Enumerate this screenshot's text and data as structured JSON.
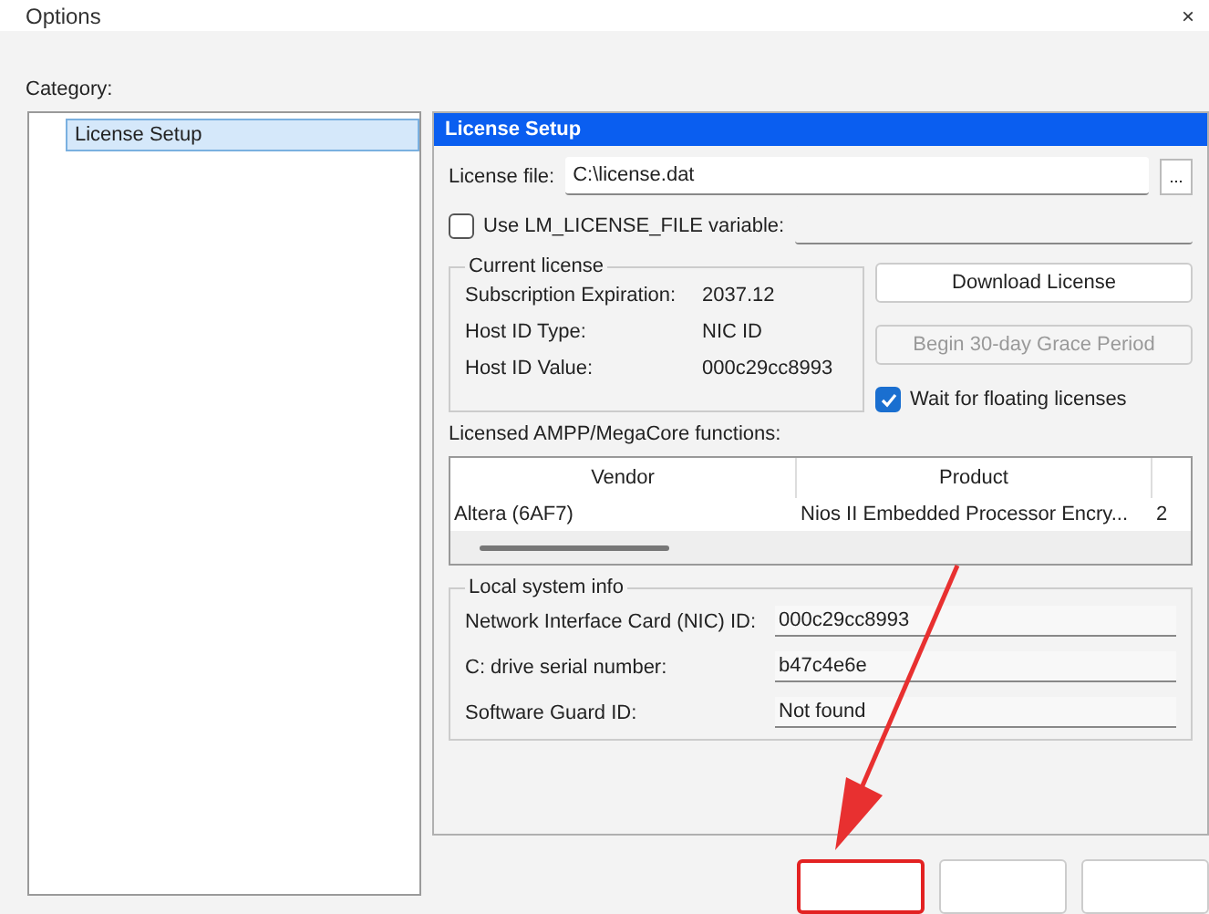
{
  "window": {
    "title": "Options",
    "close": "×"
  },
  "category_label": "Category:",
  "sidebar": {
    "items": [
      {
        "label": "License Setup",
        "selected": true
      }
    ]
  },
  "panel": {
    "title": "License Setup",
    "license_file": {
      "label": "License file:",
      "value": "C:\\license.dat",
      "browse": "..."
    },
    "lm_variable": {
      "label": "Use LM_LICENSE_FILE variable:",
      "checked": false
    },
    "current_license": {
      "title": "Current license",
      "rows": [
        {
          "label": "Subscription Expiration:",
          "value": "2037.12"
        },
        {
          "label": "Host ID Type:",
          "value": "NIC ID"
        },
        {
          "label": "Host ID Value:",
          "value": "000c29cc8993"
        }
      ]
    },
    "download_button": {
      "label": "Download License"
    },
    "grace_button": {
      "label": "Begin 30-day Grace Period",
      "disabled": true
    },
    "wait_floating": {
      "label": "Wait for floating licenses",
      "checked": true
    },
    "functions_label": "Licensed AMPP/MegaCore functions:",
    "table": {
      "columns": [
        "Vendor",
        "Product"
      ],
      "rows": [
        [
          "Altera (6AF7)",
          "Nios II Embedded Processor Encry...",
          "2"
        ]
      ]
    },
    "local_info": {
      "title": "Local system info",
      "rows": [
        {
          "label": "Network Interface Card (NIC) ID:",
          "value": "000c29cc8993"
        },
        {
          "label": "C: drive serial number:",
          "value": "b47c4e6e"
        },
        {
          "label": "Software Guard ID:",
          "value": "Not found"
        }
      ]
    }
  },
  "buttons": [
    {
      "highlighted": true
    },
    {
      "highlighted": false
    },
    {
      "highlighted": false
    }
  ]
}
